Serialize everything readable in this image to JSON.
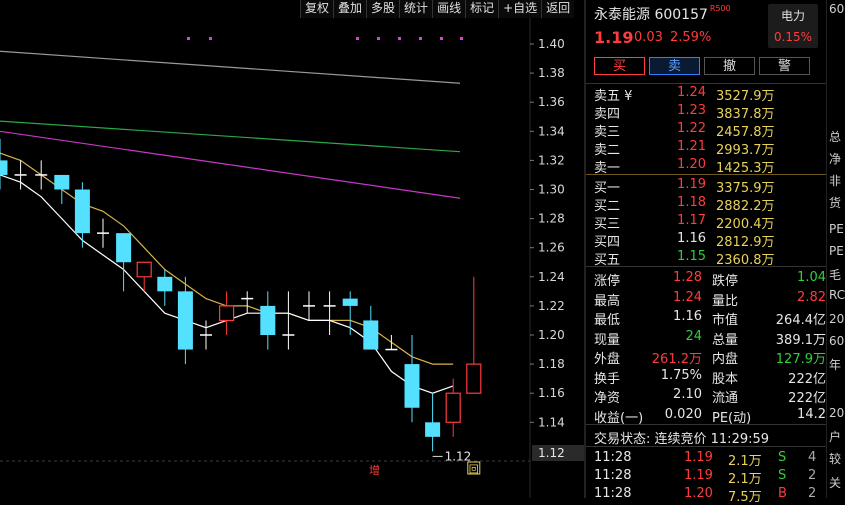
{
  "toolbar": [
    "复权",
    "叠加",
    "多股",
    "统计",
    "画线",
    "标记",
    "+自选",
    "返回"
  ],
  "price_axis": [
    "1.40",
    "1.38",
    "1.36",
    "1.34",
    "1.32",
    "1.30",
    "1.28",
    "1.26",
    "1.24",
    "1.22",
    "1.20",
    "1.18",
    "1.16",
    "1.14",
    "1.12"
  ],
  "chart_data": {
    "type": "candlestick",
    "ylim": [
      1.12,
      1.41
    ],
    "ohlc": [
      [
        1.32,
        1.335,
        1.3,
        1.31
      ],
      [
        1.31,
        1.32,
        1.3,
        1.31
      ],
      [
        1.31,
        1.32,
        1.3,
        1.31
      ],
      [
        1.31,
        1.31,
        1.29,
        1.3
      ],
      [
        1.3,
        1.305,
        1.26,
        1.27
      ],
      [
        1.27,
        1.28,
        1.26,
        1.27
      ],
      [
        1.27,
        1.27,
        1.23,
        1.25
      ],
      [
        1.24,
        1.25,
        1.23,
        1.25
      ],
      [
        1.24,
        1.245,
        1.22,
        1.23
      ],
      [
        1.23,
        1.24,
        1.18,
        1.19
      ],
      [
        1.2,
        1.21,
        1.19,
        1.2
      ],
      [
        1.21,
        1.23,
        1.2,
        1.22
      ],
      [
        1.225,
        1.23,
        1.215,
        1.225
      ],
      [
        1.22,
        1.23,
        1.19,
        1.2
      ],
      [
        1.2,
        1.23,
        1.19,
        1.2
      ],
      [
        1.22,
        1.23,
        1.21,
        1.22
      ],
      [
        1.22,
        1.23,
        1.2,
        1.22
      ],
      [
        1.225,
        1.23,
        1.2,
        1.22
      ],
      [
        1.21,
        1.22,
        1.19,
        1.19
      ],
      [
        1.19,
        1.2,
        1.19,
        1.19
      ],
      [
        1.18,
        1.2,
        1.14,
        1.15
      ],
      [
        1.14,
        1.16,
        1.12,
        1.13
      ],
      [
        1.14,
        1.17,
        1.13,
        1.16
      ],
      [
        1.16,
        1.24,
        1.16,
        1.18
      ]
    ],
    "ma_long1": [
      1.395,
      1.373
    ],
    "ma_long2": [
      1.347,
      1.326
    ],
    "ma_long3": [
      1.34,
      1.294
    ],
    "ma5": [
      1.31,
      1.305,
      1.295,
      1.28,
      1.265,
      1.255,
      1.245,
      1.23,
      1.215,
      1.21,
      1.205,
      1.21,
      1.215,
      1.215,
      1.215,
      1.21,
      1.21,
      1.205,
      1.195,
      1.175,
      1.165,
      1.16,
      1.165
    ],
    "ma10": [
      1.325,
      1.32,
      1.31,
      1.3,
      1.29,
      1.285,
      1.275,
      1.26,
      1.245,
      1.235,
      1.225,
      1.22,
      1.22,
      1.215,
      1.215,
      1.21,
      1.21,
      1.21,
      1.205,
      1.195,
      1.185,
      1.18,
      1.18
    ],
    "low_label": "1.12",
    "current_price": "1.12",
    "colors": {
      "up": "#ff3b3b",
      "down": "#54e1ff",
      "ma_white": "#ffffff",
      "ma_yellow": "#d8b24a",
      "ma_green": "#2aa84a",
      "ma_purple": "#c637c6",
      "ma_gray": "#9a9a9a"
    }
  },
  "markers": {
    "zeng": "增",
    "hui": "回"
  },
  "stock": {
    "name": "永泰能源",
    "code": "600157",
    "badge": "R500",
    "price": "1.19",
    "change": "0.03",
    "pct": "2.59%",
    "sector": "电力",
    "sector_pct": "0.15%"
  },
  "actions": [
    "买",
    "卖",
    "撤",
    "警"
  ],
  "asks": [
    {
      "label": "卖五 ¥",
      "price": "1.24",
      "vol": "3527.9万"
    },
    {
      "label": "卖四",
      "price": "1.23",
      "vol": "3837.8万"
    },
    {
      "label": "卖三",
      "price": "1.22",
      "vol": "2457.8万"
    },
    {
      "label": "卖二",
      "price": "1.21",
      "vol": "2993.7万"
    },
    {
      "label": "卖一",
      "price": "1.20",
      "vol": "1425.3万"
    }
  ],
  "bids": [
    {
      "label": "买一",
      "price": "1.19",
      "vol": "3375.9万",
      "color": "red"
    },
    {
      "label": "买二",
      "price": "1.18",
      "vol": "2882.2万",
      "color": "red"
    },
    {
      "label": "买三",
      "price": "1.17",
      "vol": "2200.4万",
      "color": "red"
    },
    {
      "label": "买四",
      "price": "1.16",
      "vol": "2812.9万",
      "color": "white"
    },
    {
      "label": "买五",
      "price": "1.15",
      "vol": "2360.8万",
      "color": "green"
    }
  ],
  "stats": [
    {
      "l1": "涨停",
      "v1": "1.28",
      "c1": "red",
      "l2": "跌停",
      "v2": "1.04",
      "c2": "green"
    },
    {
      "l1": "最高",
      "v1": "1.24",
      "c1": "red",
      "l2": "量比",
      "v2": "2.82",
      "c2": "red"
    },
    {
      "l1": "最低",
      "v1": "1.16",
      "c1": "white",
      "l2": "市值",
      "v2": "264.4亿",
      "c2": "white"
    },
    {
      "l1": "现量",
      "v1": "24",
      "c1": "green",
      "l2": "总量",
      "v2": "389.1万",
      "c2": "white"
    },
    {
      "l1": "外盘",
      "v1": "261.2万",
      "c1": "red",
      "l2": "内盘",
      "v2": "127.9万",
      "c2": "green"
    },
    {
      "l1": "换手",
      "v1": "1.75%",
      "c1": "white",
      "l2": "股本",
      "v2": "222亿",
      "c2": "white"
    },
    {
      "l1": "净资",
      "v1": "2.10",
      "c1": "white",
      "l2": "流通",
      "v2": "222亿",
      "c2": "white"
    },
    {
      "l1": "收益(一)",
      "v1": "0.020",
      "c1": "white",
      "l2": "PE(动)",
      "v2": "14.2",
      "c2": "white"
    }
  ],
  "trade_status": "交易状态: 连续竞价 11:29:59",
  "ticks": [
    {
      "time": "11:28",
      "price": "1.19",
      "qty": "2.1万",
      "dir": "S",
      "n": "4",
      "color": "red",
      "dcolor": "green"
    },
    {
      "time": "11:28",
      "price": "1.19",
      "qty": "2.1万",
      "dir": "S",
      "n": "2",
      "color": "red",
      "dcolor": "green"
    },
    {
      "time": "11:28",
      "price": "1.20",
      "qty": "7.5万",
      "dir": "B",
      "n": "2",
      "color": "red",
      "dcolor": "red"
    }
  ],
  "edge_text": [
    "60",
    "总",
    "净",
    "非",
    "货",
    "PE",
    "PE",
    "毛",
    "RC",
    "20",
    "60",
    "年",
    "20",
    "户",
    "较",
    "关"
  ]
}
